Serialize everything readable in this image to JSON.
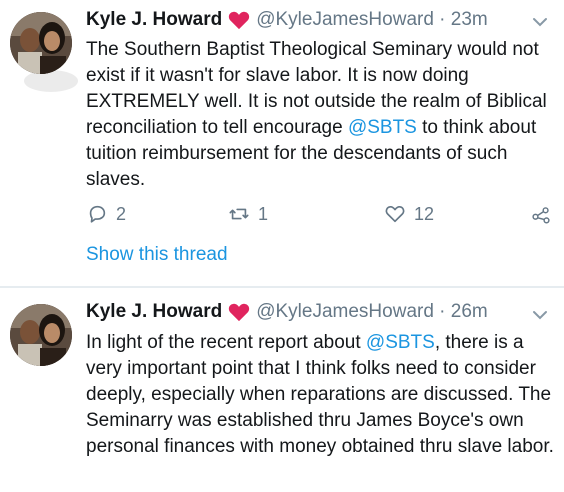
{
  "tweets": [
    {
      "author_name": "Kyle J. Howard",
      "handle_time": "@KyleJamesHoward · 23m",
      "text_before": "The Southern Baptist Theological Seminary would not exist if it wasn't for slave labor. It is now doing EXTREMELY well. It is not outside the realm of Biblical reconciliation to tell encourage ",
      "mention": "@SBTS",
      "text_after": " to think about tuition reimbursement for the descendants of such slaves.",
      "reply_count": "2",
      "retweet_count": "1",
      "like_count": "12",
      "show_thread": "Show this thread"
    },
    {
      "author_name": "Kyle J. Howard",
      "handle_time": "@KyleJamesHoward · 26m",
      "text_before": "In light of the recent report about ",
      "mention": "@SBTS",
      "text_after": ", there is a very important point that I think folks need to consider deeply, especially when reparations are discussed. The Seminarry was established thru James Boyce's own personal finances with money obtained thru slave labor."
    }
  ],
  "icons": {
    "heart_emoji": "red-heart-icon",
    "more": "chevron-down-icon",
    "reply": "reply-icon",
    "retweet": "retweet-icon",
    "like": "like-heart-icon",
    "share": "share-icon"
  },
  "colors": {
    "text": "#14171a",
    "secondary": "#657786",
    "link": "#1b95e0",
    "heart_red": "#e0245e",
    "divider": "#e6ecf0"
  }
}
